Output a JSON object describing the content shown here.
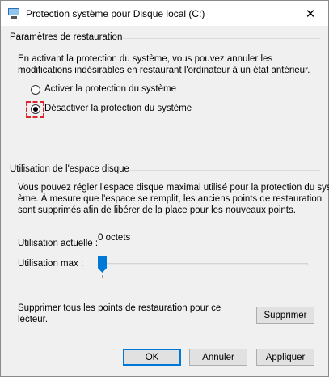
{
  "window": {
    "title": "Protection système pour Disque local  (C:)",
    "close_glyph": "✕"
  },
  "restore_settings": {
    "heading": "Paramètres de restauration",
    "description_line1": "En activant la protection du système, vous pouvez annuler les",
    "description_line2": "modifications indésirables en restaurant l'ordinateur à un état antérieur.",
    "options": [
      {
        "label": "Activer la protection du système",
        "checked": false
      },
      {
        "label": "Désactiver la protection du système",
        "checked": true
      }
    ]
  },
  "disk_usage": {
    "heading": "Utilisation de l'espace disque",
    "description_line1": "Vous pouvez régler l'espace disque maximal utilisé pour la protection du syst",
    "description_line2": "ème. À mesure que l'espace se remplit, les anciens points de restauration",
    "description_line3": "sont supprimés afin de libérer de la place pour les nouveaux points.",
    "current_label": "Utilisation actuelle :",
    "current_value": "0 octets",
    "max_label": "Utilisation max :",
    "max_slider_level": 0
  },
  "delete_section": {
    "text_line1": "Supprimer tous les points de restauration pour ce",
    "text_line2": "lecteur.",
    "button": "Supprimer"
  },
  "footer": {
    "ok": "OK",
    "cancel": "Annuler",
    "apply": "Appliquer"
  },
  "colors": {
    "accent": "#0078d7",
    "focus_marker": "#e0242f"
  }
}
